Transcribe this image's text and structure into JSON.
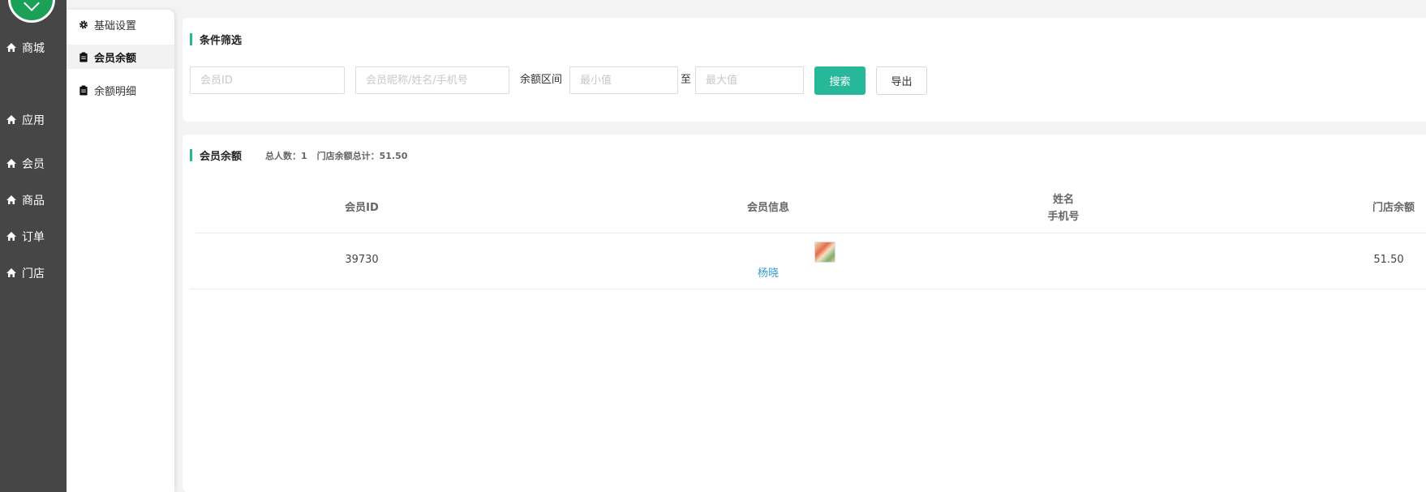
{
  "nav": {
    "items": [
      {
        "label": "商城",
        "icon": "home-icon"
      },
      {
        "label": "应用",
        "icon": "home-icon"
      },
      {
        "label": "会员",
        "icon": "home-icon"
      },
      {
        "label": "商品",
        "icon": "home-icon"
      },
      {
        "label": "订单",
        "icon": "home-icon"
      },
      {
        "label": "门店",
        "icon": "home-icon"
      }
    ]
  },
  "subnav": {
    "items": [
      {
        "label": "基础设置",
        "icon": "gear-icon"
      },
      {
        "label": "会员余额",
        "icon": "clipboard-icon",
        "active": true
      },
      {
        "label": "余额明细",
        "icon": "clipboard-icon"
      }
    ]
  },
  "filter": {
    "title": "条件筛选",
    "member_id_placeholder": "会员ID",
    "member_search_placeholder": "会员昵称/姓名/手机号",
    "range_label": "余额区间",
    "min_placeholder": "最小值",
    "to_label": "至",
    "max_placeholder": "最大值",
    "search_button": "搜索",
    "export_button": "导出"
  },
  "list": {
    "title": "会员余额",
    "total_people": "总人数：1",
    "store_total": "门店余额总计：51.50",
    "columns": {
      "member_id": "会员ID",
      "member_info": "会员信息",
      "name": "姓名",
      "phone": "手机号",
      "store_balance": "门店余额"
    },
    "rows": [
      {
        "member_id": "39730",
        "nickname": "杨晓",
        "name": "",
        "phone": "",
        "store_balance": "51.50"
      }
    ]
  },
  "colors": {
    "accent": "#26b899",
    "nav_bg": "#464646",
    "link": "#3a9ad9"
  }
}
